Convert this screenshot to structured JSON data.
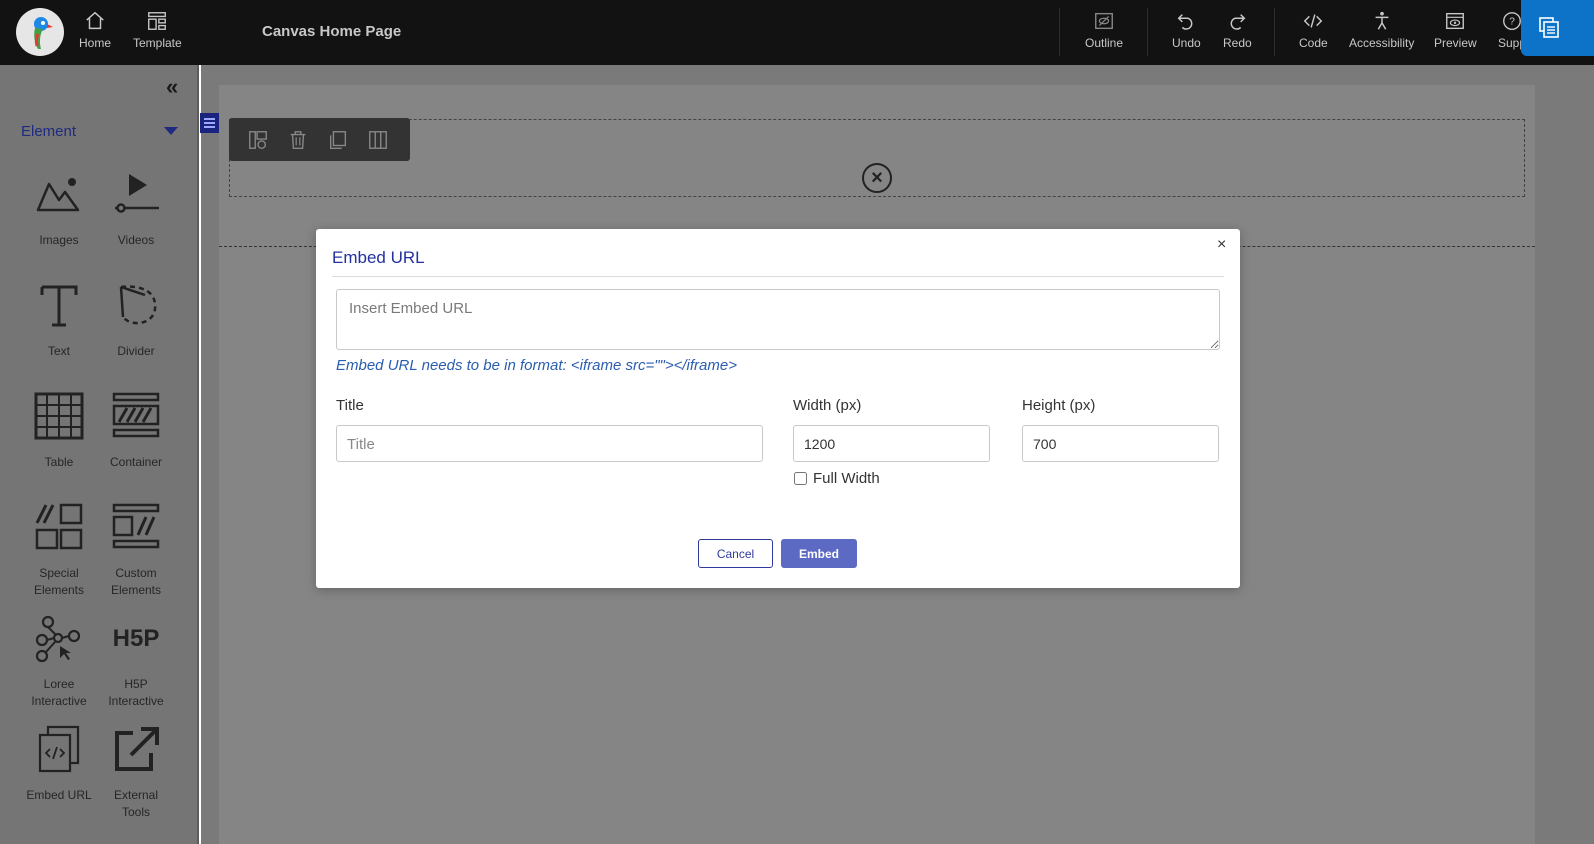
{
  "topbar": {
    "page_title": "Canvas Home Page",
    "left_nav": [
      {
        "label": "Home",
        "icon": "home-icon"
      },
      {
        "label": "Template",
        "icon": "template-icon"
      }
    ],
    "right_nav": [
      {
        "label": "Outline",
        "icon": "outline-icon"
      },
      {
        "label": "Undo",
        "icon": "undo-icon"
      },
      {
        "label": "Redo",
        "icon": "redo-icon"
      },
      {
        "label": "Code",
        "icon": "code-icon"
      },
      {
        "label": "Accessibility",
        "icon": "accessibility-icon"
      },
      {
        "label": "Preview",
        "icon": "preview-icon"
      },
      {
        "label": "Supp",
        "icon": "help-icon"
      }
    ]
  },
  "sidebar": {
    "section_label": "Element",
    "tiles": [
      {
        "label": "Images",
        "icon": "images-icon"
      },
      {
        "label": "Videos",
        "icon": "videos-icon"
      },
      {
        "label": "Text",
        "icon": "text-icon"
      },
      {
        "label": "Divider",
        "icon": "divider-icon"
      },
      {
        "label": "Table",
        "icon": "table-icon"
      },
      {
        "label": "Container",
        "icon": "container-icon"
      },
      {
        "label": "Special Elements",
        "icon": "special-elements-icon"
      },
      {
        "label": "Custom Elements",
        "icon": "custom-elements-icon"
      },
      {
        "label": "Loree Interactive",
        "icon": "loree-interactive-icon"
      },
      {
        "label": "H5P Interactive",
        "icon": "h5p-icon"
      },
      {
        "label": "Embed URL",
        "icon": "embed-url-icon"
      },
      {
        "label": "External Tools",
        "icon": "external-tools-icon"
      }
    ]
  },
  "modal": {
    "title": "Embed URL",
    "close": "×",
    "url_placeholder": "Insert Embed URL",
    "hint": "Embed URL needs to be in format: <iframe src=\"\"></iframe>",
    "title_label": "Title",
    "title_placeholder": "Title",
    "width_label": "Width (px)",
    "width_value": "1200",
    "height_label": "Height (px)",
    "height_value": "700",
    "full_width_label": "Full Width",
    "full_width_checked": false,
    "cancel_label": "Cancel",
    "embed_label": "Embed"
  },
  "colors": {
    "accent": "#5c6ac4",
    "title_blue": "#22319e",
    "topbar": "#121212",
    "corner_button": "#0d73c8"
  }
}
